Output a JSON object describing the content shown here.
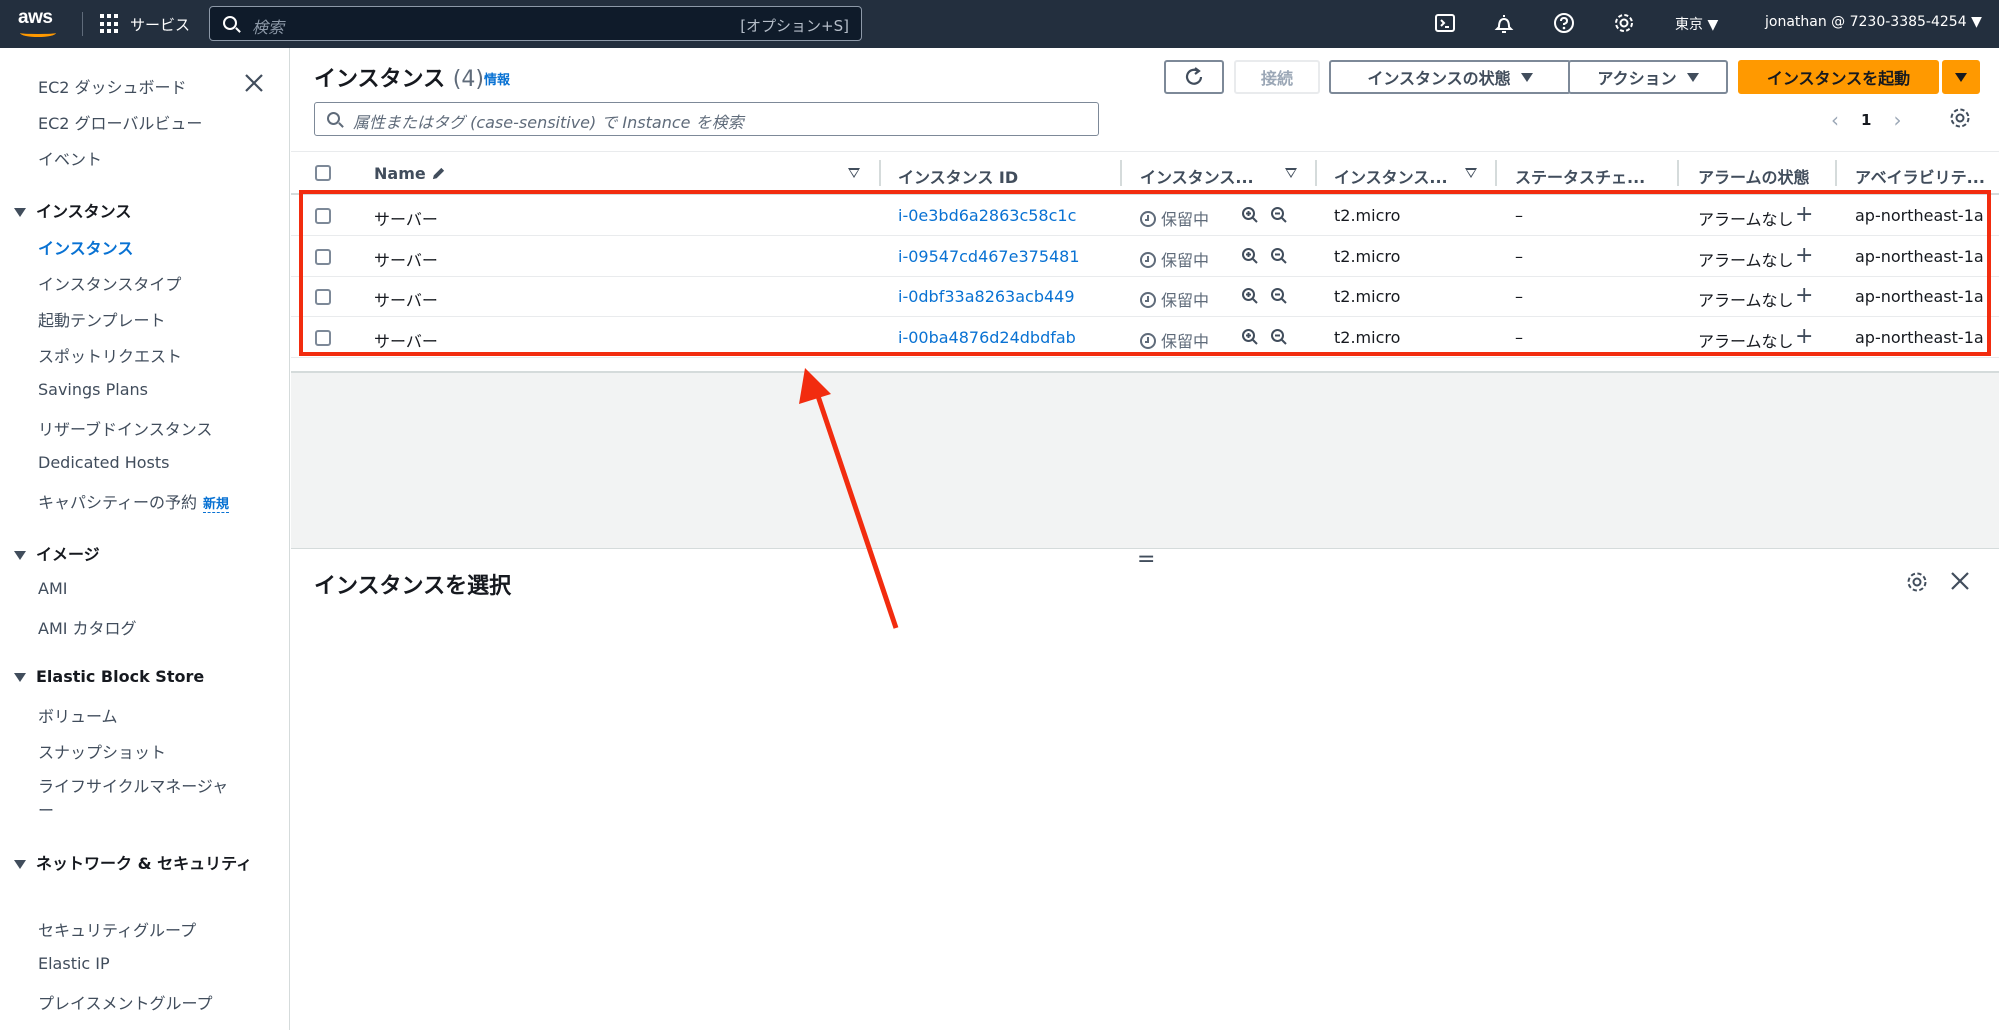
{
  "topnav": {
    "logo_text": "aws",
    "services_label": "サービス",
    "search_placeholder": "検索",
    "search_shortcut": "[オプション+S]",
    "region": "東京 ▼",
    "account": "jonathan @ 7230-3385-4254 ▼"
  },
  "sidebar": {
    "top_items": [
      "EC2 ダッシュボード",
      "EC2 グローバルビュー",
      "イベント"
    ],
    "sections": [
      {
        "title": "インスタンス",
        "items": [
          "インスタンス",
          "インスタンスタイプ",
          "起動テンプレート",
          "スポットリクエスト",
          "Savings Plans",
          "リザーブドインスタンス",
          "Dedicated Hosts",
          "キャパシティーの予約"
        ],
        "active": "インスタンス",
        "new_badge": "新規"
      },
      {
        "title": "イメージ",
        "items": [
          "AMI",
          "AMI カタログ"
        ]
      },
      {
        "title": "Elastic Block Store",
        "items": [
          "ボリューム",
          "スナップショット",
          "ライフサイクルマネージャー"
        ]
      },
      {
        "title": "ネットワーク & セキュリティ",
        "items": [
          "セキュリティグループ",
          "Elastic IP",
          "プレイスメントグループ"
        ]
      }
    ]
  },
  "main": {
    "title": "インスタンス",
    "count": "(4)",
    "info_link": "情報",
    "buttons": {
      "connect": "接続",
      "instance_state": "インスタンスの状態",
      "actions": "アクション",
      "launch": "インスタンスを起動"
    },
    "table_search_placeholder": "属性またはタグ (case-sensitive) で Instance を検索",
    "page_number": "1",
    "columns": [
      "Name",
      "インスタンス ID",
      "インスタンス...",
      "インスタンス...",
      "ステータスチェ...",
      "アラームの状態",
      "アベイラビリテ..."
    ],
    "rows": [
      {
        "name": "サーバー",
        "id": "i-0e3bd6a2863c58c1c",
        "state": "保留中",
        "type": "t2.micro",
        "status": "–",
        "alarm": "アラームなし",
        "az": "ap-northeast-1a"
      },
      {
        "name": "サーバー",
        "id": "i-09547cd467e375481",
        "state": "保留中",
        "type": "t2.micro",
        "status": "–",
        "alarm": "アラームなし",
        "az": "ap-northeast-1a"
      },
      {
        "name": "サーバー",
        "id": "i-0dbf33a8263acb449",
        "state": "保留中",
        "type": "t2.micro",
        "status": "–",
        "alarm": "アラームなし",
        "az": "ap-northeast-1a"
      },
      {
        "name": "サーバー",
        "id": "i-00ba4876d24dbdfab",
        "state": "保留中",
        "type": "t2.micro",
        "status": "–",
        "alarm": "アラームなし",
        "az": "ap-northeast-1a"
      }
    ],
    "detail_title": "インスタンスを選択"
  },
  "colors": {
    "nav_bg": "#232f3e",
    "accent_orange": "#ff9900",
    "link_blue": "#0972d3",
    "annotation_red": "#f22c0f"
  }
}
